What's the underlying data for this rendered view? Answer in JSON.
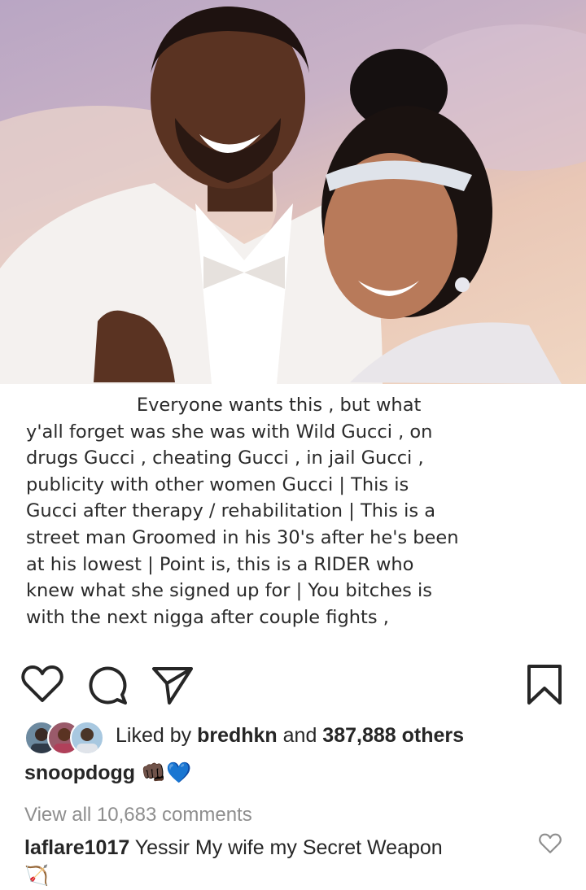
{
  "post": {
    "image_caption_lines": [
      "                   Everyone wants this , but what",
      "y'all forget was she was with Wild Gucci , on",
      "drugs Gucci , cheating Gucci , in jail Gucci ,",
      "publicity with other women Gucci | This is",
      "Gucci after therapy / rehabilitation | This is a",
      "street man Groomed in his 30's after he's been",
      "at his lowest | Point is, this is a RIDER who",
      "knew what she signed up for | You bitches is",
      "with the next nigga after couple fights ,"
    ]
  },
  "likes": {
    "prefix": "Liked by ",
    "user": "bredhkn",
    "middle": " and ",
    "count": "387,888 others"
  },
  "caption": {
    "username": "snoopdogg",
    "emoji": "👊🏿💙"
  },
  "comments": {
    "view_all": "View all 10,683 comments",
    "top": {
      "username": "laflare1017",
      "text": " Yessir My wife my Secret Weapon",
      "emoji": "🏹"
    }
  },
  "colors": {
    "text": "#262626",
    "muted": "#8e8e8e",
    "heart_emoji": "#3897f0"
  },
  "icons": [
    "heart-icon",
    "comment-icon",
    "share-icon",
    "bookmark-icon",
    "like-comment-heart-icon"
  ]
}
